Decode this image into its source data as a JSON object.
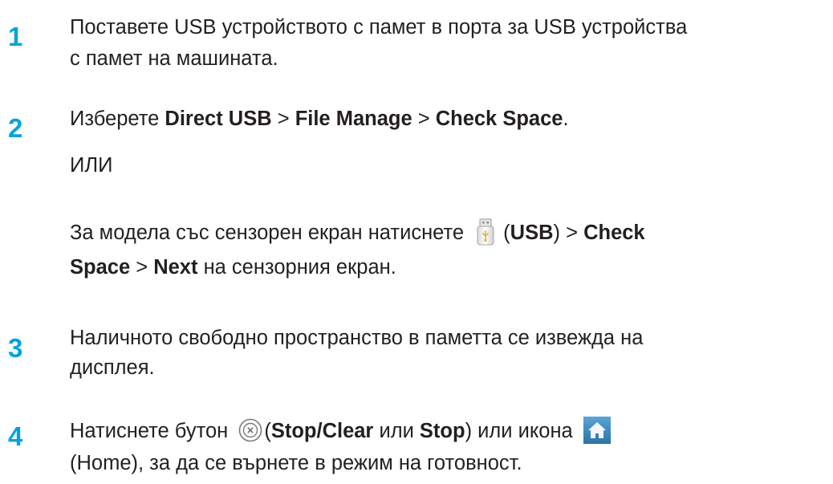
{
  "steps": [
    {
      "number": "1",
      "line1": "Поставете USB устройството с памет в порта за USB устройства",
      "line2": "с памет на машината."
    },
    {
      "number": "2",
      "intro": "Изберете ",
      "path1": "Direct USB",
      "sep1": " > ",
      "path2": "File Manage",
      "sep2": " > ",
      "path3": "Check Space",
      "end": ".",
      "or": "ИЛИ",
      "alt_intro": "За модела със сензорен екран натиснете ",
      "alt_open": "(",
      "alt_usb": "USB",
      "alt_close": ") > ",
      "alt_check": "Check",
      "alt_space": "Space",
      "alt_sep": " > ",
      "alt_next": "Next",
      "alt_end": " на сензорния екран."
    },
    {
      "number": "3",
      "line1": "Наличното свободно пространство в паметта се извежда на",
      "line2": "дисплея."
    },
    {
      "number": "4",
      "intro": "Натиснете бутон ",
      "open": "(",
      "stop_clear": "Stop/Clear",
      "or_word": " или ",
      "stop": "Stop",
      "mid": ") или икона ",
      "line2": "(Home), за да се върнете в режим на готовност."
    }
  ],
  "icons": {
    "usb": "usb-memory-icon",
    "stop": "stop-clear-icon",
    "home": "home-icon"
  },
  "colors": {
    "step_number": "#00a3e0",
    "text": "#231f20",
    "home_icon_bg": "#3d8fc4"
  }
}
